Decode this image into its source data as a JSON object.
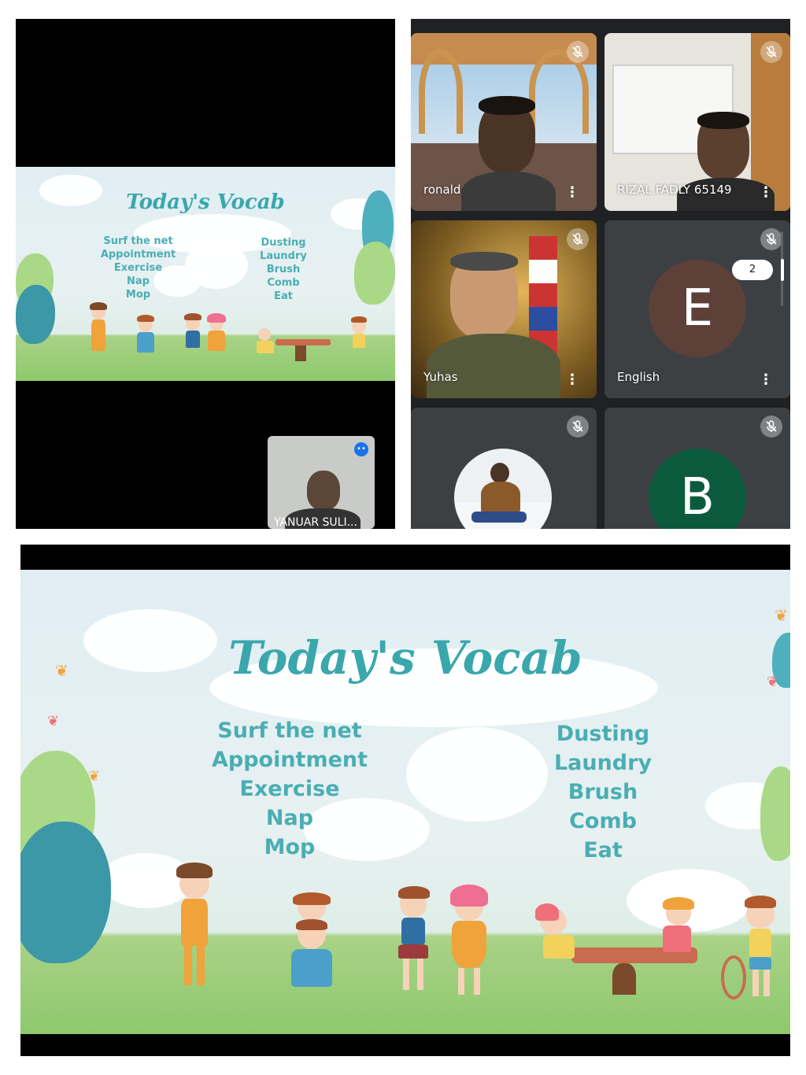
{
  "screen_share": {
    "slide": {
      "title": "Today's Vocab",
      "left_words": [
        "Surf the net",
        "Appointment",
        "Exercise",
        "Nap",
        "Mop"
      ],
      "right_words": [
        "Dusting",
        "Laundry",
        "Brush",
        "Comb",
        "Eat"
      ]
    },
    "self_tile": {
      "name": "YANUAR SULI..."
    }
  },
  "participants": [
    {
      "name": "ronald",
      "muted": true
    },
    {
      "name": "RIZAL FADLY 65149",
      "muted": true
    },
    {
      "name": "Yuhas",
      "muted": true
    },
    {
      "name": "English",
      "muted": true,
      "avatar_letter": "E",
      "avatar_color": "#5d4037"
    },
    {
      "name": "",
      "muted": true
    },
    {
      "name": "",
      "muted": true,
      "avatar_letter": "B",
      "avatar_color": "#0b5a3d"
    }
  ],
  "pagination": {
    "page": "2"
  },
  "large_slide": {
    "title": "Today's Vocab",
    "left_words": [
      "Surf the net",
      "Appointment",
      "Exercise",
      "Nap",
      "Mop"
    ],
    "right_words": [
      "Dusting",
      "Laundry",
      "Brush",
      "Comb",
      "Eat"
    ]
  },
  "colors": {
    "slide_text": "#4aaeb3",
    "meet_background": "#202124",
    "tile_background": "#3c4043"
  }
}
